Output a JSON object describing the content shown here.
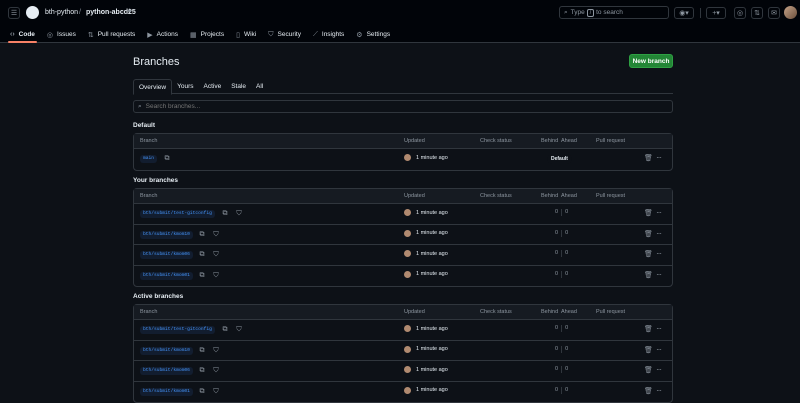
{
  "header": {
    "owner": "bth-python",
    "separator": "/",
    "repo": "python-abcd25",
    "search_prefix": "Type",
    "search_key": "/",
    "search_suffix": "to search"
  },
  "repo_tabs": [
    {
      "label": "Code",
      "icon": "code-icon"
    },
    {
      "label": "Issues",
      "icon": "issue-icon"
    },
    {
      "label": "Pull requests",
      "icon": "pull-request-icon"
    },
    {
      "label": "Actions",
      "icon": "play-icon"
    },
    {
      "label": "Projects",
      "icon": "table-icon"
    },
    {
      "label": "Wiki",
      "icon": "book-icon"
    },
    {
      "label": "Security",
      "icon": "shield-icon"
    },
    {
      "label": "Insights",
      "icon": "graph-icon"
    },
    {
      "label": "Settings",
      "icon": "gear-icon"
    }
  ],
  "page": {
    "title": "Branches",
    "new_branch": "New branch",
    "subtabs": [
      "Overview",
      "Yours",
      "Active",
      "Stale",
      "All"
    ],
    "search_placeholder": "Search branches..."
  },
  "columns": {
    "branch": "Branch",
    "updated": "Updated",
    "check": "Check status",
    "behind": "Behind",
    "ahead": "Ahead",
    "pr": "Pull request"
  },
  "sections": {
    "default": {
      "title": "Default",
      "rows": [
        {
          "name": "main",
          "updated": "1 minute ago",
          "badge": "Default"
        }
      ]
    },
    "yours": {
      "title": "Your branches",
      "rows": [
        {
          "name": "bth/submit/test-gitconfig",
          "updated": "1 minute ago",
          "behind": "0",
          "ahead": "0"
        },
        {
          "name": "bth/submit/kmom10",
          "updated": "1 minute ago",
          "behind": "0",
          "ahead": "0"
        },
        {
          "name": "bth/submit/kmom06",
          "updated": "1 minute ago",
          "behind": "0",
          "ahead": "0"
        },
        {
          "name": "bth/submit/kmom01",
          "updated": "1 minute ago",
          "behind": "0",
          "ahead": "0"
        }
      ]
    },
    "active": {
      "title": "Active branches",
      "rows": [
        {
          "name": "bth/submit/test-gitconfig",
          "updated": "1 minute ago",
          "behind": "0",
          "ahead": "0"
        },
        {
          "name": "bth/submit/kmom10",
          "updated": "1 minute ago",
          "behind": "0",
          "ahead": "0"
        },
        {
          "name": "bth/submit/kmom06",
          "updated": "1 minute ago",
          "behind": "0",
          "ahead": "0"
        },
        {
          "name": "bth/submit/kmom01",
          "updated": "1 minute ago",
          "behind": "0",
          "ahead": "0"
        }
      ]
    }
  },
  "colors": {
    "accent_green": "#238636",
    "branch_blue": "#4493f8",
    "tab_underline": "#f78166"
  }
}
